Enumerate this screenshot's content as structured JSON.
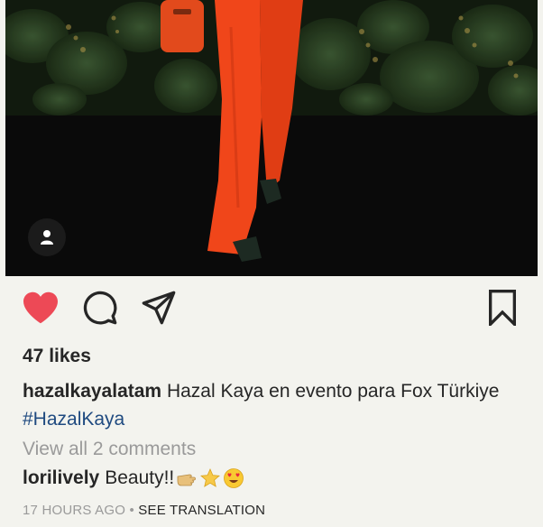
{
  "post": {
    "likes": "47 likes",
    "caption": {
      "username": "hazalkayalatam",
      "text": " Hazal Kaya en evento para Fox Türkiye ",
      "hashtag": "#HazalKaya"
    },
    "view_comments": "View all 2 comments",
    "comment": {
      "username": "lorilively",
      "text": "Beauty!!"
    },
    "time_ago": "17 HOURS AGO",
    "separator": " • ",
    "see_translation": "SEE TRANSLATION"
  },
  "icons": {
    "like": "heart-icon",
    "comment": "comment-icon",
    "share": "paper-plane-icon",
    "save": "bookmark-icon",
    "user_tag": "person-icon",
    "comment_emojis": [
      "pointing-hand-emoji",
      "star-emoji",
      "heart-eyes-emoji"
    ]
  },
  "colors": {
    "like_active": "#ed4956",
    "hashtag": "#1f4a80",
    "muted": "#9a9a9a",
    "text": "#262626",
    "background": "#f3f3ee"
  }
}
